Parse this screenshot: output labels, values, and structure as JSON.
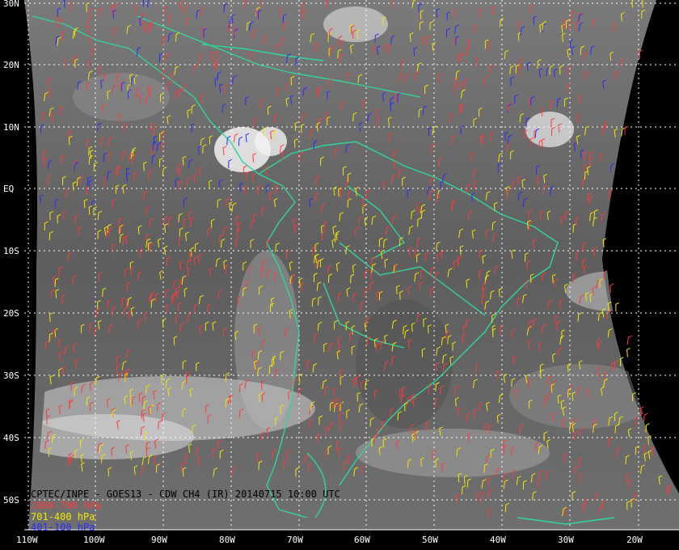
{
  "title": "CPTEC/INPE - GOES13 - CDW CH4 (IR) 20140715 10:00 UTC",
  "legend": [
    {
      "label": "1000-700 hPa",
      "color": "#ff3b3b"
    },
    {
      "label": "701-400 hPa",
      "color": "#f2e600"
    },
    {
      "label": "401-100 hPa",
      "color": "#2b2bff"
    }
  ],
  "lat_labels": [
    "30N",
    "20N",
    "10N",
    "EQ",
    "10S",
    "20S",
    "30S",
    "40S",
    "50S"
  ],
  "lon_labels": [
    "110W",
    "100W",
    "90W",
    "80W",
    "70W",
    "60W",
    "50W",
    "40W",
    "30W",
    "20W"
  ],
  "colors": {
    "background": "#000000",
    "coast": "#2fd69a",
    "grid": "#ffffff",
    "caption": "#ffffff"
  }
}
